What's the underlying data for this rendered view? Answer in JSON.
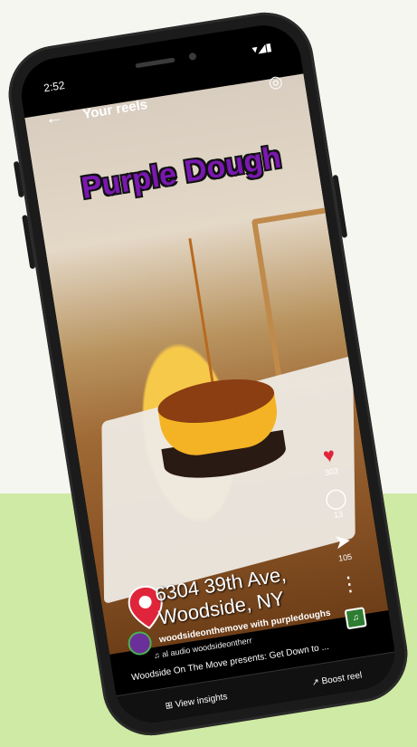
{
  "status_bar": {
    "time": "2:52",
    "right_icons": "▾◢▮"
  },
  "header": {
    "back_icon": "←",
    "title": "Your reels",
    "camera_icon": "◎"
  },
  "overlay_title": "Purple Dough",
  "address": {
    "line1": "6304 39th Ave,",
    "line2": "Woodside, NY"
  },
  "actions": {
    "likes": "303",
    "comments": "13",
    "shares": "105"
  },
  "owner": {
    "handle": "woodsideonthemove",
    "with": "with purpledoughs",
    "audio": "al audio  woodsideontherr"
  },
  "caption": "Woodside On The Move presents: Get Down to ...",
  "bottom": {
    "insights": "View insights",
    "boost": "Boost reel"
  },
  "nav": {
    "back": "‹",
    "home": "○",
    "recents": "|||"
  }
}
